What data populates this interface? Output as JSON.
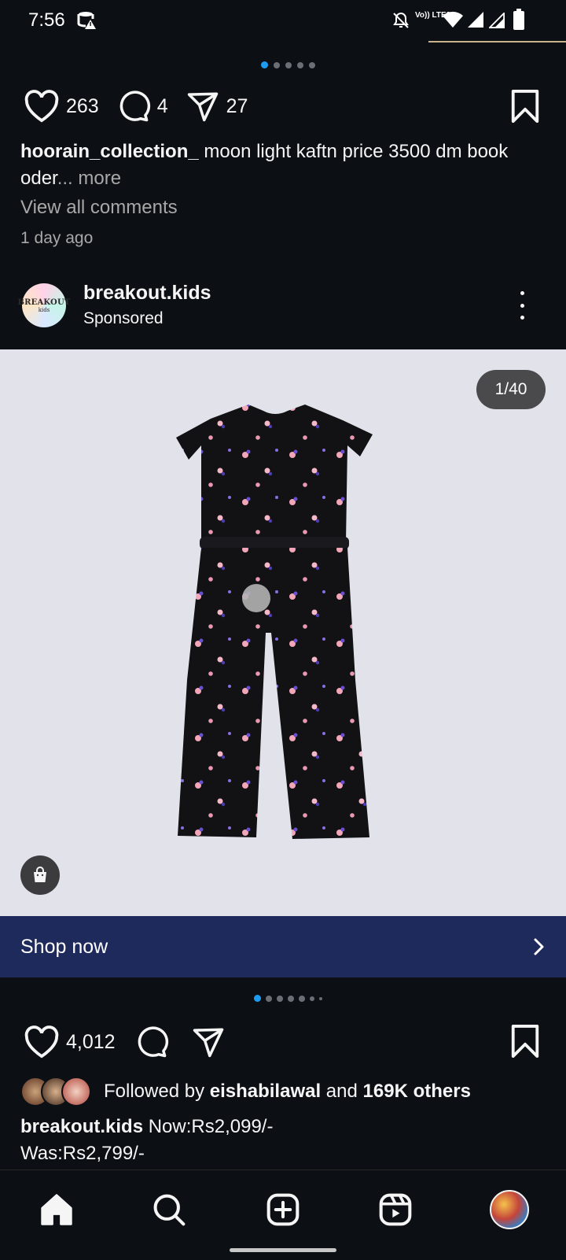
{
  "status_bar": {
    "time": "7:56",
    "icons": [
      "data-saver-icon",
      "mute-icon",
      "volte-lte2-icon",
      "wifi-icon",
      "signal-icon",
      "signal-icon-2",
      "battery-icon"
    ],
    "volte_label": "Vo)) LTE2"
  },
  "prev_post": {
    "carousel_dots": 5,
    "carousel_active": 0,
    "likes": "263",
    "comments": "4",
    "shares": "27",
    "caption_user": "hoorain_collection_",
    "caption_text": " moon light kaftn price 3500 dm book oder",
    "caption_more": "... more",
    "view_comments": "View all comments",
    "time_ago": "1 day ago"
  },
  "sponsored_post": {
    "brand_logo_text": "BREAKOUT",
    "brand_logo_sub": "kids",
    "username": "breakout.kids",
    "label": "Sponsored",
    "media_counter": "1/40",
    "cta_label": "Shop now",
    "carousel_dots": 7,
    "carousel_active": 0,
    "likes": "4,012",
    "followed_prefix": "Followed by ",
    "followed_user": "eishabilawal",
    "followed_and": " and ",
    "followed_others": "169K others",
    "caption_user": "breakout.kids",
    "caption_line1": " Now:Rs2,099/-",
    "caption_line2": "Was:Rs2,799/-"
  },
  "nav": {
    "items": [
      "home-icon",
      "search-icon",
      "create-icon",
      "reels-icon",
      "profile-avatar"
    ]
  },
  "colors": {
    "background": "#0c1014",
    "accent_dot": "#1d9bf0",
    "cta_bar": "#1f2a5c",
    "media_bg": "#e2e2ea"
  }
}
